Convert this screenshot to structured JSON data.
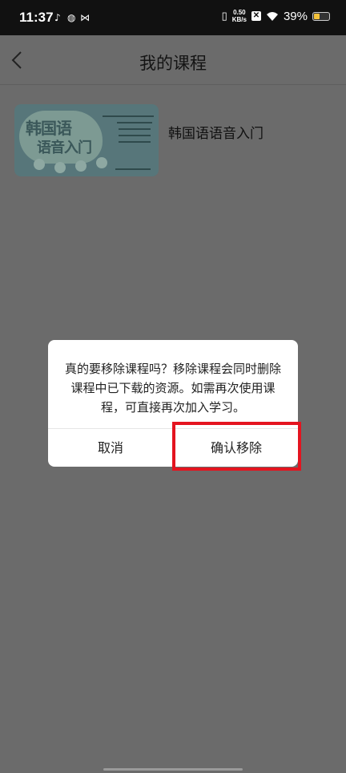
{
  "status_bar": {
    "time": "11:37",
    "app_icons": [
      "tiktok-icon",
      "ring-icon",
      "butterfly-icon"
    ],
    "speed_value": "0.50",
    "speed_unit": "KB/s",
    "battery_percent": "39%",
    "battery_level": 0.39
  },
  "nav": {
    "back_icon": "chevron-left-icon",
    "title": "我的课程"
  },
  "courses": [
    {
      "name": "韩国语语音入门",
      "cover_title_line1": "韩国语",
      "cover_title_line2": "语音入门"
    }
  ],
  "dialog": {
    "message": "真的要移除课程吗？移除课程会同时删除课程中已下载的资源。如需再次使用课程，可直接再次加入学习。",
    "cancel_label": "取消",
    "confirm_label": "确认移除"
  },
  "colors": {
    "overlay": "#6b6b6b",
    "highlight": "#e4141f",
    "battery": "#f4c23a"
  }
}
